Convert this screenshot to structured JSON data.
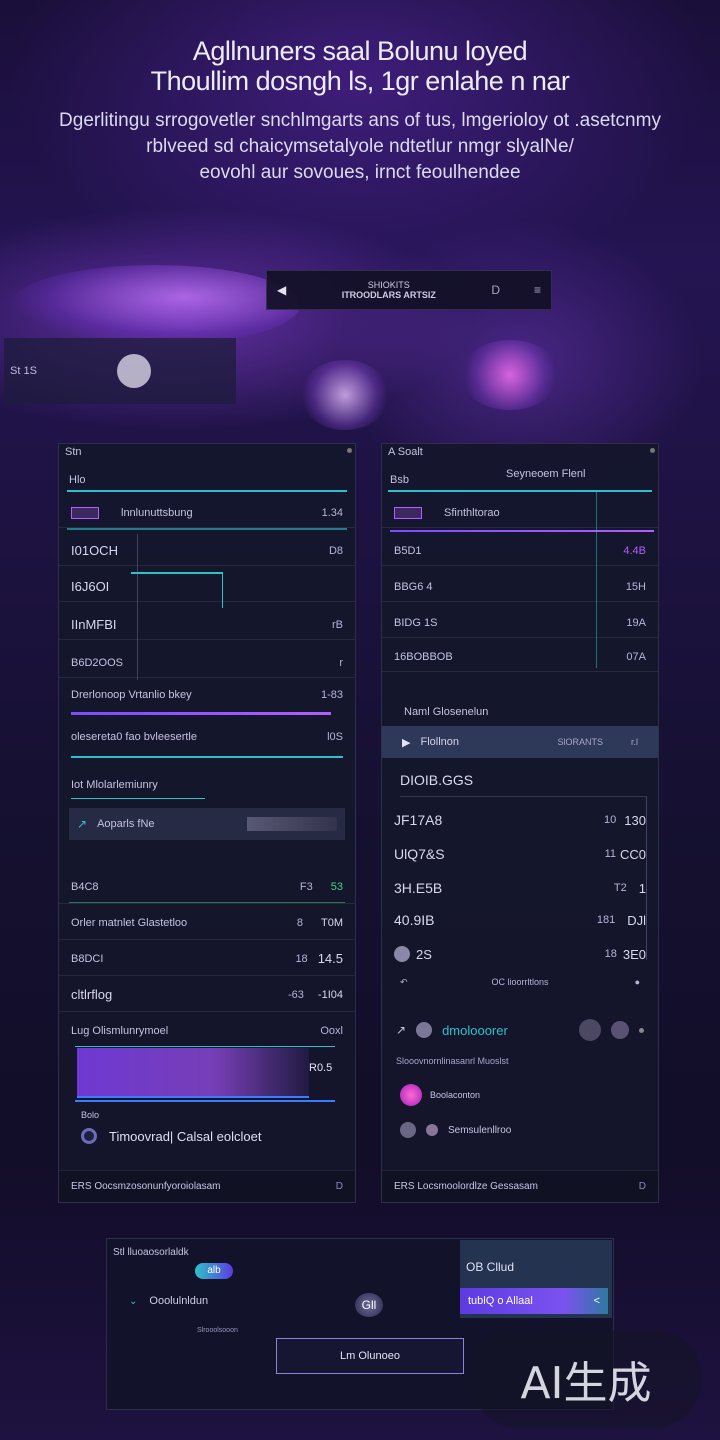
{
  "hero": {
    "title_line1": "Agllnuners saal Bolunu loyed",
    "title_line2": "Thoullim dosngh ls, 1gr enlahe n nar",
    "desc_line1": "Dgerlitingu srrogovetler snchlmgarts ans of tus, lmgerioloy ot .asetcnmy",
    "desc_line2": "rblveed sd chaicymsetalyole ndtetlur nmgr slyalNe/",
    "desc_line3": "eovohl aur sovoues, irnct feoulhendee"
  },
  "toolbar": {
    "back_icon": "back-arrow-icon",
    "title_top": "SHIOKITS",
    "title_bottom": "ITROODLARS ARTSIZ",
    "icon1": "D",
    "icon2": "≡"
  },
  "strip": {
    "label": "St 1S"
  },
  "left_panel": {
    "header": "Stn",
    "sub": "Hlo",
    "rows": [
      {
        "label": "lnnlunuttsbung",
        "value": "1.34"
      },
      {
        "label": "I01OCH",
        "value": "D8"
      },
      {
        "label": "I6J6OI",
        "value": ""
      },
      {
        "label": "IInMFBI",
        "value": "rB"
      },
      {
        "label": "B6D2OOS",
        "value": "r"
      }
    ],
    "slider1_label": "Drerlonoop Vrtanlio bkey",
    "slider1_value": "1-83",
    "slider2_label": "olesereta0 fao bvleesertle",
    "slider2_value": "l0S",
    "tab_label": "Iot Mlolarlemiunry",
    "input_label": "Aoparls fNe",
    "stats": [
      {
        "label": "B4C8",
        "v1": "F3",
        "v2": "53"
      },
      {
        "label": "Orler matnlet Glastetloo",
        "v1": "8",
        "v2": "T0M"
      },
      {
        "label": "B8DCI",
        "v1": "18",
        "v2": "14.5"
      },
      {
        "label": "cltlrflog",
        "v1": "-63",
        "v2": "-1I04"
      }
    ],
    "chart_label": "Lug Olismlunrymoel",
    "chart_corner": "Ooxl",
    "chart_value": "R0.5",
    "chart_small": "Bolo",
    "user_label": "Timoovrad| Calsal eolcloet",
    "footer": "ERS   Oocsmzosonunfyoroiolasam",
    "footer_icon": "D"
  },
  "right_panel": {
    "header": "A Soalt",
    "sub": "Bsb",
    "title": "Seyneoem Flenl",
    "rows": [
      {
        "label": "Sfinthltorao",
        "value": ""
      },
      {
        "label": "B5D1",
        "value": "4.4B"
      },
      {
        "label": "BBG6 4",
        "value": "15H"
      },
      {
        "label": "BIDG 1S",
        "value": "19A"
      },
      {
        "label": "16BOBBOB",
        "value": "07A"
      }
    ],
    "section_label": "Naml Glosenelun",
    "tab_label": "Flollnon",
    "tab_right": "SlORANTS",
    "tab_right2": "r.l",
    "list_header": "DIOIB.GGS",
    "stats": [
      {
        "label": "JF17A8",
        "v1": "10",
        "v2": "130"
      },
      {
        "label": "UlQ7&S",
        "v1": "11",
        "v2": "CC0"
      },
      {
        "label": "3H.E5B",
        "v1": "T2",
        "v2": "1"
      },
      {
        "label": "40.9IB",
        "v1": "181",
        "v2": "DJl"
      },
      {
        "label": "2S",
        "v1": "18",
        "v2": "3E0"
      }
    ],
    "center_caption": "OC lioorrltlons",
    "tools_title": "dmolooorer",
    "tools_sub": "Slooovnornlinasanrl Muoslst",
    "legend1": "Boolaconton",
    "legend2": "Semsulenllroo",
    "footer": "ERS   Locsmoolordlze Gessasam",
    "footer_icon": "D"
  },
  "card": {
    "top_label": "Stl   lluoaosorlaldk",
    "chip_label": "alb",
    "row_label": "Ooolulnldun",
    "center_label": "Gll",
    "small_label": "Slrooolsooon",
    "green_label": "OB Cllud",
    "bar_label": "tublQ o Allaal",
    "bar_icon": "<"
  },
  "cta": {
    "label": "Lm Olunoeo"
  },
  "watermark": {
    "text": "AI生成"
  },
  "colors": {
    "accent_cyan": "#2fc1c9",
    "accent_purple": "#b45cff",
    "pink": "#ef3a6c",
    "green": "#43d18a"
  }
}
